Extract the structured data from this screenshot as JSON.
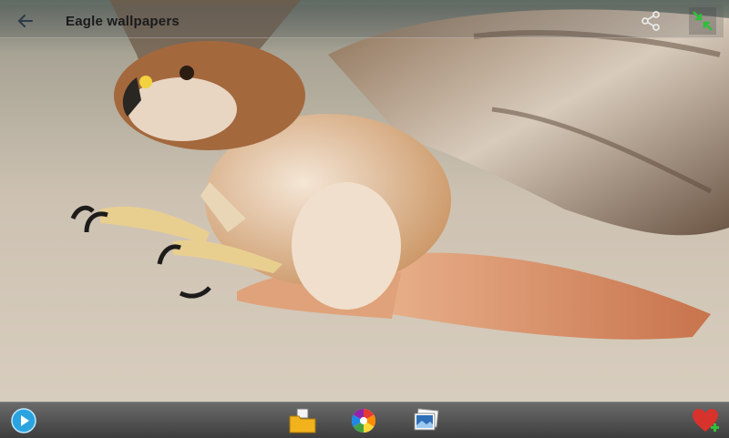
{
  "header": {
    "title": "Eagle wallpapers",
    "back_icon": "arrow-left-icon",
    "share_icon": "share-icon",
    "fullscreen_icon": "collapse-arrows-icon"
  },
  "wallpaper": {
    "subject": "eagle-photo"
  },
  "toolbar": {
    "items": [
      {
        "icon": "slideshow-play-icon"
      },
      {
        "icon": "folder-icon"
      },
      {
        "icon": "color-wheel-icon"
      },
      {
        "icon": "image-gallery-icon"
      },
      {
        "icon": "favorite-heart-add-icon"
      }
    ]
  },
  "colors": {
    "accent_green": "#2fbf3a",
    "bar_dark": "#3d3d3d",
    "heart_red": "#d8322d"
  }
}
